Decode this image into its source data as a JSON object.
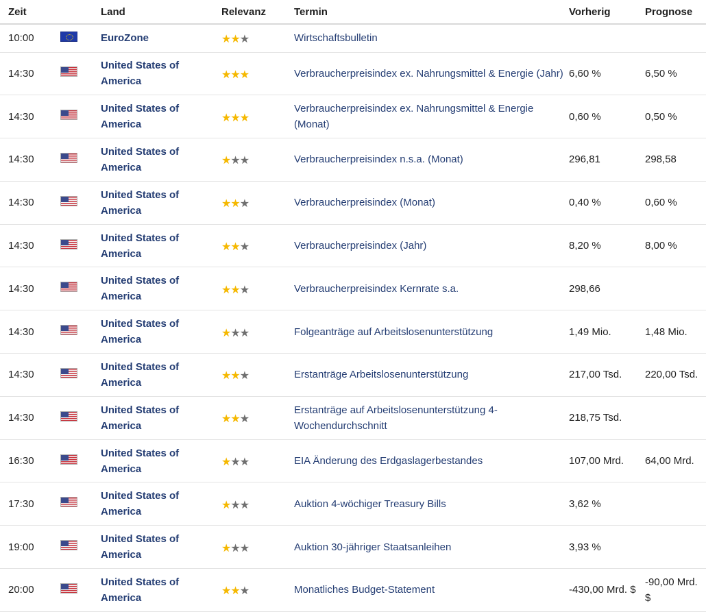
{
  "header": {
    "zeit": "Zeit",
    "land": "Land",
    "relevanz": "Relevanz",
    "termin": "Termin",
    "vorherig": "Vorherig",
    "prognose": "Prognose"
  },
  "star_glyph": "★",
  "colors": {
    "link": "#243d73",
    "star_on": "#f5b800",
    "star_off": "#6f6f6f"
  },
  "rows": [
    {
      "zeit": "10:00",
      "flag": "eu-flag-icon",
      "land": "EuroZone",
      "stars": 2,
      "termin": "Wirtschaftsbulletin",
      "vorherig": "",
      "prognose": ""
    },
    {
      "zeit": "14:30",
      "flag": "us-flag-icon",
      "land": "United States of America",
      "stars": 3,
      "termin": "Verbraucherpreisindex ex. Nahrungsmittel & Energie (Jahr)",
      "vorherig": "6,60 %",
      "prognose": "6,50 %"
    },
    {
      "zeit": "14:30",
      "flag": "us-flag-icon",
      "land": "United States of America",
      "stars": 3,
      "termin": "Verbraucherpreisindex ex. Nahrungsmittel & Energie (Monat)",
      "vorherig": "0,60 %",
      "prognose": "0,50 %"
    },
    {
      "zeit": "14:30",
      "flag": "us-flag-icon",
      "land": "United States of America",
      "stars": 1,
      "termin": "Verbraucherpreisindex n.s.a. (Monat)",
      "vorherig": "296,81",
      "prognose": "298,58"
    },
    {
      "zeit": "14:30",
      "flag": "us-flag-icon",
      "land": "United States of America",
      "stars": 2,
      "termin": "Verbraucherpreisindex (Monat)",
      "vorherig": "0,40 %",
      "prognose": "0,60 %"
    },
    {
      "zeit": "14:30",
      "flag": "us-flag-icon",
      "land": "United States of America",
      "stars": 2,
      "termin": "Verbraucherpreisindex (Jahr)",
      "vorherig": "8,20 %",
      "prognose": "8,00 %"
    },
    {
      "zeit": "14:30",
      "flag": "us-flag-icon",
      "land": "United States of America",
      "stars": 2,
      "termin": "Verbraucherpreisindex Kernrate s.a.",
      "vorherig": "298,66",
      "prognose": ""
    },
    {
      "zeit": "14:30",
      "flag": "us-flag-icon",
      "land": "United States of America",
      "stars": 1,
      "termin": "Folgeanträge auf Arbeitslosenunterstützung",
      "vorherig": "1,49 Mio.",
      "prognose": "1,48 Mio."
    },
    {
      "zeit": "14:30",
      "flag": "us-flag-icon",
      "land": "United States of America",
      "stars": 2,
      "termin": "Erstanträge Arbeitslosenunterstützung",
      "vorherig": "217,00 Tsd.",
      "prognose": "220,00 Tsd."
    },
    {
      "zeit": "14:30",
      "flag": "us-flag-icon",
      "land": "United States of America",
      "stars": 2,
      "termin": "Erstanträge auf Arbeitslosenunterstützung 4-Wochendurchschnitt",
      "vorherig": "218,75 Tsd.",
      "prognose": ""
    },
    {
      "zeit": "16:30",
      "flag": "us-flag-icon",
      "land": "United States of America",
      "stars": 1,
      "termin": "EIA Änderung des Erdgaslagerbestandes",
      "vorherig": "107,00 Mrd.",
      "prognose": "64,00 Mrd."
    },
    {
      "zeit": "17:30",
      "flag": "us-flag-icon",
      "land": "United States of America",
      "stars": 1,
      "termin": "Auktion 4-wöchiger Treasury Bills",
      "vorherig": "3,62 %",
      "prognose": ""
    },
    {
      "zeit": "19:00",
      "flag": "us-flag-icon",
      "land": "United States of America",
      "stars": 1,
      "termin": "Auktion 30-jähriger Staatsanleihen",
      "vorherig": "3,93 %",
      "prognose": ""
    },
    {
      "zeit": "20:00",
      "flag": "us-flag-icon",
      "land": "United States of America",
      "stars": 2,
      "termin": "Monatliches Budget-Statement",
      "vorherig": "-430,00 Mrd. $",
      "prognose": "-90,00 Mrd. $"
    }
  ]
}
